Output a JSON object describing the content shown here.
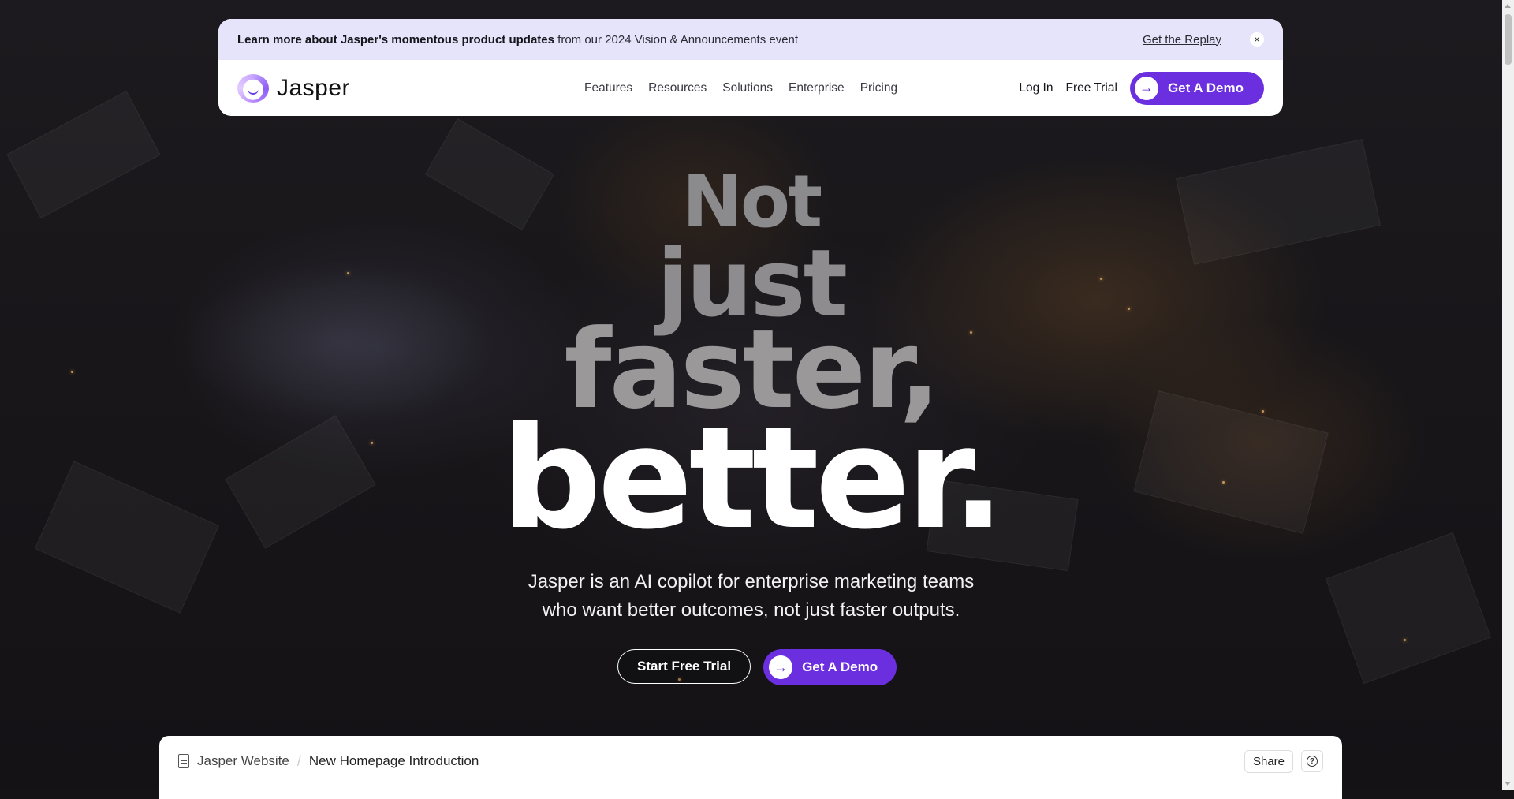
{
  "announcement": {
    "bold": "Learn more about Jasper's momentous product updates",
    "rest": " from our 2024 Vision & Announcements event",
    "link": "Get the Replay",
    "close": "×"
  },
  "nav": {
    "logo": "Jasper",
    "menu": [
      "Features",
      "Resources",
      "Solutions",
      "Enterprise",
      "Pricing"
    ],
    "login": "Log In",
    "free_trial": "Free Trial",
    "demo": "Get A Demo",
    "arrow": "→"
  },
  "hero": {
    "line1": "Not",
    "line2": "just",
    "line3": "faster,",
    "line4": "better.",
    "sub_line1": "Jasper is an AI copilot for enterprise marketing teams",
    "sub_line2": "who want better outcomes, not just faster outputs.",
    "cta_trial": "Start Free Trial",
    "cta_demo": "Get A Demo",
    "arrow": "→"
  },
  "editor": {
    "project": "Jasper Website",
    "separator": "/",
    "document": "New Homepage Introduction",
    "share": "Share",
    "help": "?"
  },
  "colors": {
    "accent": "#6b2fe0",
    "announce_bg": "#e6e4fb"
  }
}
